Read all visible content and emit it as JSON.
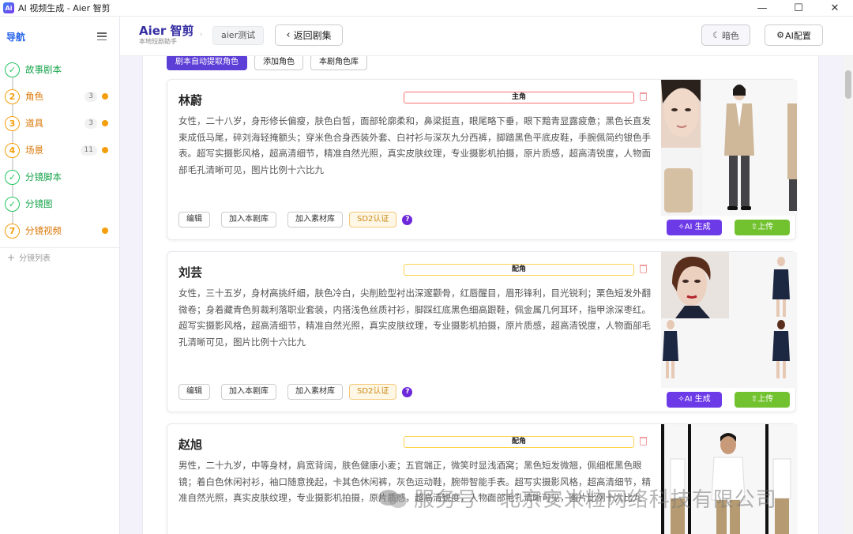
{
  "window": {
    "title": "AI 视频生成 - Aier 智剪",
    "logo_text": "Ai"
  },
  "sidebar": {
    "title": "导航",
    "steps": [
      {
        "num": "✓",
        "label": "故事剧本",
        "status": "done"
      },
      {
        "num": "2",
        "label": "角色",
        "count": "3",
        "status": "todo"
      },
      {
        "num": "3",
        "label": "道具",
        "count": "3",
        "status": "todo"
      },
      {
        "num": "4",
        "label": "场景",
        "count": "11",
        "status": "todo"
      },
      {
        "num": "✓",
        "label": "分镜脚本",
        "status": "done"
      },
      {
        "num": "✓",
        "label": "分镜图",
        "status": "done"
      },
      {
        "num": "7",
        "label": "分镜视频",
        "status": "todo"
      }
    ],
    "sub_list_label": "分镜列表"
  },
  "header": {
    "brand_name": "Aier 智剪",
    "brand_sub": "本地短剧助手",
    "project": "aier测试",
    "back_label": "返回剧集",
    "dark_label": "暗色",
    "config_label": "AI配置"
  },
  "actions": {
    "extract": "剧本自动提取角色",
    "add": "添加角色",
    "library": "本剧角色库"
  },
  "card_buttons": {
    "edit": "编辑",
    "add_script_lib": "加入本剧库",
    "add_asset_lib": "加入素材库",
    "sd2": "SD2认证",
    "help": "?",
    "ai_generate": "AI 生成",
    "upload": "上传"
  },
  "characters": [
    {
      "name": "林蔚",
      "role": "主角",
      "description": "女性，二十八岁，身形修长偏瘦，肤色白皙，面部轮廓柔和，鼻梁挺直，眼尾略下垂，眼下黯青显露疲惫；黑色长直发束成低马尾，碎刘海轻掩额头；穿米色合身西装外套、白衬衫与深灰九分西裤，脚踏黑色平底皮鞋，手腕佩简约银色手表。超写实摄影风格，超高清细节，精准自然光照，真实皮肤纹理，专业摄影机拍摄，原片质感，超高清锐度，人物面部毛孔清晰可见，图片比例十六比九"
    },
    {
      "name": "刘芸",
      "role": "配角",
      "description": "女性，三十五岁，身材高挑纤细，肤色冷白，尖削脸型衬出深邃颧骨，红唇醒目，眉形锋利，目光锐利；栗色短发外翻微卷；身着藏青色剪裁利落职业套装，内搭浅色丝质衬衫，脚踩红底黑色细高跟鞋，佩金属几何耳环，指甲涂深枣红。超写实摄影风格，超高清细节，精准自然光照，真实皮肤纹理，专业摄影机拍摄，原片质感，超高清锐度，人物面部毛孔清晰可见，图片比例十六比九"
    },
    {
      "name": "赵旭",
      "role": "配角",
      "description": "男性，二十九岁，中等身材，肩宽背阔，肤色健康小麦；五官端正，微笑时显浅酒窝；黑色短发微翘，佩细框黑色眼镜；着白色休闲衬衫，袖口随意挽起，卡其色休闲裤，灰色运动鞋，腕带智能手表。超写实摄影风格，超高清细节，精准自然光照，真实皮肤纹理，专业摄影机拍摄，原片质感，超高清锐度，人物面部毛孔清晰可见，图片比例十六比九"
    }
  ],
  "watermark": "服务号 · 北京安米粒网络科技有限公司"
}
